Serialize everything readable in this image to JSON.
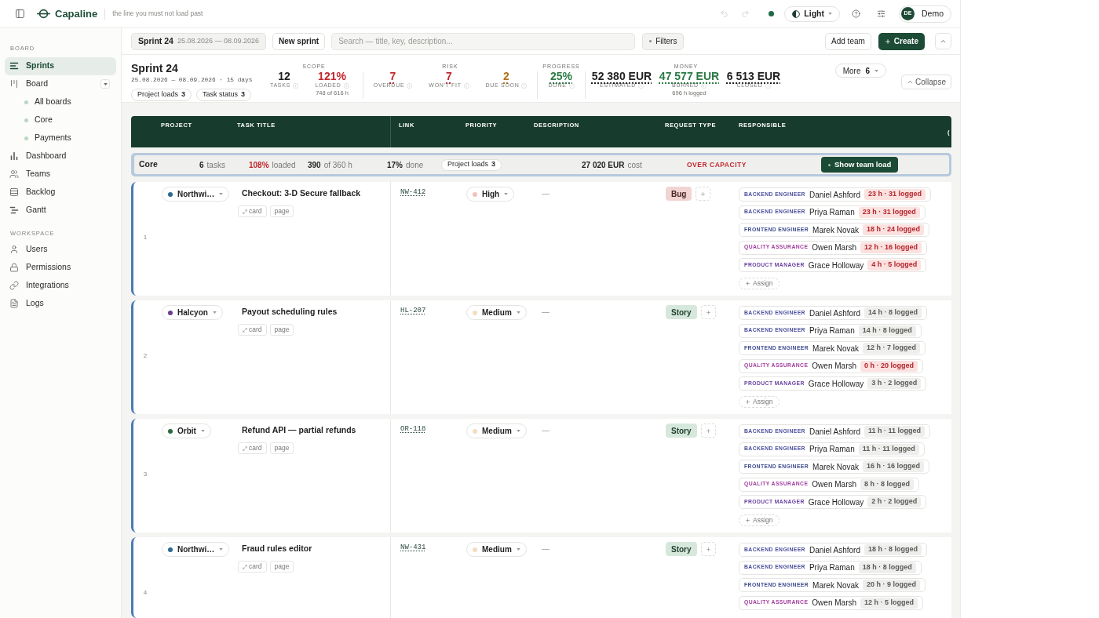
{
  "top_bar": {
    "app_name": "Capaline",
    "tagline": "the line you must not load past",
    "undo": {
      "disabled": true
    },
    "redo": {
      "disabled": true
    },
    "theme": {
      "label": "Light"
    },
    "user": {
      "initials": "DE",
      "name": "Demo"
    }
  },
  "sidebar": {
    "sections": [
      {
        "title": "BOARD",
        "items": [
          {
            "label": "Sprints",
            "selected": true
          },
          {
            "label": "Board",
            "selected": false,
            "expanded": true,
            "children": [
              {
                "label": "All boards",
                "selected": false
              },
              {
                "label": "Core",
                "selected": false
              },
              {
                "label": "Payments",
                "selected": false
              }
            ]
          },
          {
            "label": "Dashboard",
            "selected": false
          },
          {
            "label": "Teams",
            "selected": false
          },
          {
            "label": "Backlog",
            "selected": false
          },
          {
            "label": "Gantt",
            "selected": false
          }
        ]
      },
      {
        "title": "WORKSPACE",
        "items": [
          {
            "label": "Users",
            "selected": false
          },
          {
            "label": "Permissions",
            "selected": false
          },
          {
            "label": "Integrations",
            "selected": false
          },
          {
            "label": "Logs",
            "selected": false
          }
        ]
      }
    ]
  },
  "toolbar": {
    "sprint_picker": {
      "name": "Sprint 24",
      "dates": "25.08.2026 — 08.09.2026"
    },
    "new_sprint": "New sprint",
    "search": {
      "placeholder": "Search — title, key, description..."
    },
    "filters": "Filters",
    "add_team": "Add team",
    "create": "Create"
  },
  "sprint_header": {
    "title": "Sprint 24",
    "dates": "25.08.2026 — 08.09.2026 · 15 days",
    "pills": [
      {
        "label": "Project loads",
        "count": "3"
      },
      {
        "label": "Task status",
        "count": "3"
      }
    ],
    "stat_groups": [
      {
        "title": "SCOPE",
        "stats": [
          {
            "value": "12",
            "label": "TASKS",
            "color": "#1f1f1f",
            "underlined": false
          },
          {
            "value": "121%",
            "label": "LOADED",
            "sub": "748 of 616 h",
            "color": "#c3272e",
            "underlined": false
          }
        ]
      },
      {
        "title": "RISK",
        "stats": [
          {
            "value": "7",
            "label": "OVERDUE",
            "color": "#c3272e",
            "underlined": true
          },
          {
            "value": "7",
            "label": "WON'T FIT",
            "color": "#c3272e",
            "underlined": true
          },
          {
            "value": "2",
            "label": "DUE SOON",
            "color": "#b0731c",
            "underlined": true
          }
        ]
      },
      {
        "title": "PROGRESS",
        "stats": [
          {
            "value": "25%",
            "label": "DONE",
            "color": "#2b7a45",
            "underlined": true
          }
        ]
      },
      {
        "title": "MONEY",
        "stats": [
          {
            "value": "52 380 EUR",
            "label": "ESTIMATED",
            "color": "#1f1f1f",
            "underlined": true
          },
          {
            "value": "47 577 EUR",
            "label": "BURNED",
            "sub": "696 h logged",
            "color": "#2b7a45",
            "underlined": true
          },
          {
            "value": "6 513 EUR",
            "label": "CLOSED",
            "color": "#1f1f1f",
            "underlined": true
          }
        ]
      }
    ],
    "more": {
      "label": "More",
      "count": "6"
    },
    "collapse": "Collapse"
  },
  "table": {
    "columns": [
      "PROJECT",
      "TASK TITLE",
      "LINK",
      "PRIORITY",
      "DESCRIPTION",
      "REQUEST TYPE",
      "RESPONSIBLE",
      "("
    ],
    "group": {
      "name": "Core",
      "stats": [
        {
          "value": "6",
          "unit": "tasks",
          "color": "#1f1f1f"
        },
        {
          "value": "108%",
          "unit": "loaded",
          "color": "#c3272e"
        },
        {
          "value": "390",
          "unit": "of 360 h",
          "color": "#1f1f1f"
        },
        {
          "value": "17%",
          "unit": "done",
          "color": "#1f1f1f"
        }
      ],
      "pill": {
        "label": "Project loads",
        "count": "3"
      },
      "cost": {
        "value": "27 020 EUR",
        "unit": "cost"
      },
      "status": "OVER CAPACITY",
      "action": "Show team load"
    },
    "rows": [
      {
        "number": "1",
        "project": {
          "name": "Northwi…",
          "color": "#2b6a8f"
        },
        "title": "Checkout: 3-D Secure fallback",
        "chips": [
          {
            "kind": "card",
            "label": "card"
          },
          {
            "kind": "page",
            "label": "page"
          }
        ],
        "link": "NW-412",
        "priority": {
          "label": "High",
          "color": "#f1c2bf"
        },
        "description": "—",
        "request_type": {
          "kind": "bug",
          "label": "Bug"
        },
        "assignees": [
          {
            "role": {
              "label": "BACKEND ENGINEER",
              "color": "#4c4f9c"
            },
            "name": "Daniel Ashford",
            "hours": "23 h · 31 logged",
            "over": true
          },
          {
            "role": {
              "label": "BACKEND ENGINEER",
              "color": "#4c4f9c"
            },
            "name": "Priya Raman",
            "hours": "23 h · 31 logged",
            "over": true
          },
          {
            "role": {
              "label": "FRONTEND ENGINEER",
              "color": "#3e4c8f"
            },
            "name": "Marek Novak",
            "hours": "18 h · 24 logged",
            "over": true
          },
          {
            "role": {
              "label": "QUALITY ASSURANCE",
              "color": "#a2409f"
            },
            "name": "Owen Marsh",
            "hours": "12 h · 16 logged",
            "over": true
          },
          {
            "role": {
              "label": "PRODUCT MANAGER",
              "color": "#6b44a0"
            },
            "name": "Grace Holloway",
            "hours": "4 h · 5 logged",
            "over": true
          }
        ],
        "assign": "Assign"
      },
      {
        "number": "2",
        "project": {
          "name": "Halcyon",
          "color": "#6b3f8f"
        },
        "title": "Payout scheduling rules",
        "chips": [
          {
            "kind": "card",
            "label": "card"
          },
          {
            "kind": "page",
            "label": "page"
          }
        ],
        "link": "HL-207",
        "priority": {
          "label": "Medium",
          "color": "#f2dcc2"
        },
        "description": "—",
        "request_type": {
          "kind": "story",
          "label": "Story"
        },
        "assignees": [
          {
            "role": {
              "label": "BACKEND ENGINEER",
              "color": "#4c4f9c"
            },
            "name": "Daniel Ashford",
            "hours": "14 h · 8 logged",
            "over": false
          },
          {
            "role": {
              "label": "BACKEND ENGINEER",
              "color": "#4c4f9c"
            },
            "name": "Priya Raman",
            "hours": "14 h · 8 logged",
            "over": false
          },
          {
            "role": {
              "label": "FRONTEND ENGINEER",
              "color": "#3e4c8f"
            },
            "name": "Marek Novak",
            "hours": "12 h · 7 logged",
            "over": false
          },
          {
            "role": {
              "label": "QUALITY ASSURANCE",
              "color": "#a2409f"
            },
            "name": "Owen Marsh",
            "hours": "0 h · 20 logged",
            "over": true
          },
          {
            "role": {
              "label": "PRODUCT MANAGER",
              "color": "#6b44a0"
            },
            "name": "Grace Holloway",
            "hours": "3 h · 2 logged",
            "over": false
          }
        ],
        "assign": "Assign"
      },
      {
        "number": "3",
        "project": {
          "name": "Orbit",
          "color": "#2d6a3e"
        },
        "title": "Refund API — partial refunds",
        "chips": [
          {
            "kind": "card",
            "label": "card"
          },
          {
            "kind": "page",
            "label": "page"
          }
        ],
        "link": "OR-118",
        "priority": {
          "label": "Medium",
          "color": "#f2dcc2"
        },
        "description": "—",
        "request_type": {
          "kind": "story",
          "label": "Story"
        },
        "assignees": [
          {
            "role": {
              "label": "BACKEND ENGINEER",
              "color": "#4c4f9c"
            },
            "name": "Daniel Ashford",
            "hours": "11 h · 11 logged",
            "over": false
          },
          {
            "role": {
              "label": "BACKEND ENGINEER",
              "color": "#4c4f9c"
            },
            "name": "Priya Raman",
            "hours": "11 h · 11 logged",
            "over": false
          },
          {
            "role": {
              "label": "FRONTEND ENGINEER",
              "color": "#3e4c8f"
            },
            "name": "Marek Novak",
            "hours": "16 h · 16 logged",
            "over": false
          },
          {
            "role": {
              "label": "QUALITY ASSURANCE",
              "color": "#a2409f"
            },
            "name": "Owen Marsh",
            "hours": "8 h · 8 logged",
            "over": false
          },
          {
            "role": {
              "label": "PRODUCT MANAGER",
              "color": "#6b44a0"
            },
            "name": "Grace Holloway",
            "hours": "2 h · 2 logged",
            "over": false
          }
        ],
        "assign": "Assign"
      },
      {
        "number": "4",
        "project": {
          "name": "Northwi…",
          "color": "#2b6a8f"
        },
        "title": "Fraud rules editor",
        "chips": [
          {
            "kind": "card",
            "label": "card"
          },
          {
            "kind": "page",
            "label": "page"
          }
        ],
        "link": "NW-431",
        "priority": {
          "label": "Medium",
          "color": "#f2dcc2"
        },
        "description": "—",
        "request_type": {
          "kind": "story",
          "label": "Story"
        },
        "assignees": [
          {
            "role": {
              "label": "BACKEND ENGINEER",
              "color": "#4c4f9c"
            },
            "name": "Daniel Ashford",
            "hours": "18 h · 8 logged",
            "over": false
          },
          {
            "role": {
              "label": "BACKEND ENGINEER",
              "color": "#4c4f9c"
            },
            "name": "Priya Raman",
            "hours": "18 h · 8 logged",
            "over": false
          },
          {
            "role": {
              "label": "FRONTEND ENGINEER",
              "color": "#3e4c8f"
            },
            "name": "Marek Novak",
            "hours": "20 h · 9 logged",
            "over": false
          },
          {
            "role": {
              "label": "QUALITY ASSURANCE",
              "color": "#a2409f"
            },
            "name": "Owen Marsh",
            "hours": "12 h · 5 logged",
            "over": false
          }
        ]
      }
    ]
  }
}
